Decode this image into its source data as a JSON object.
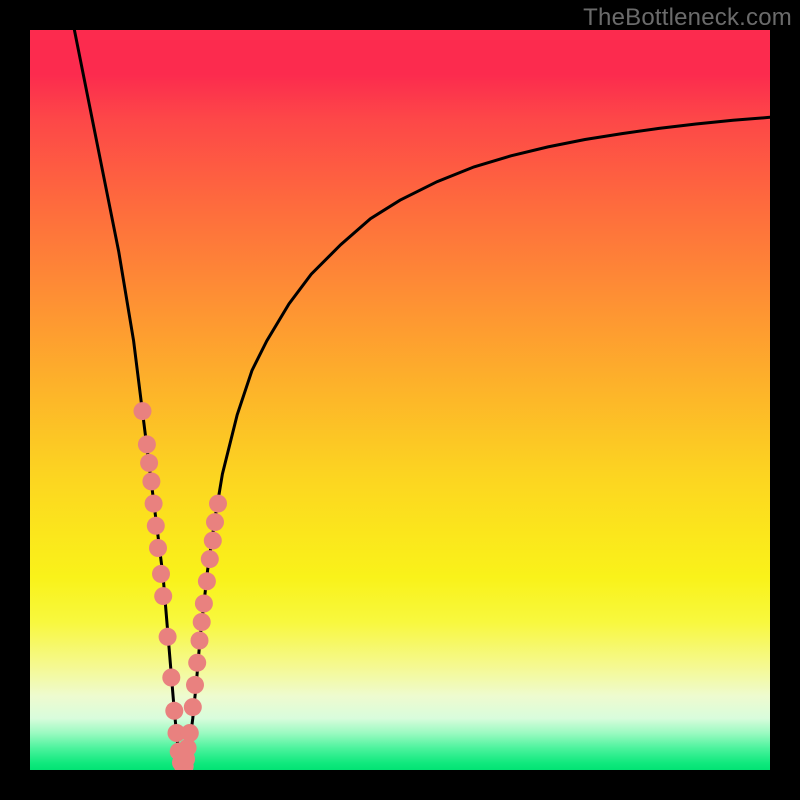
{
  "watermark": "TheBottleneck.com",
  "colors": {
    "frame": "#000000",
    "curve": "#000000",
    "marker": "#e9817f",
    "gradient_top": "#fc2b4e",
    "gradient_bottom": "#02e374"
  },
  "chart_data": {
    "type": "line",
    "title": "",
    "xlabel": "",
    "ylabel": "",
    "xlim": [
      0,
      100
    ],
    "ylim": [
      0,
      100
    ],
    "series": [
      {
        "name": "bottleneck-curve",
        "x": [
          6,
          8,
          10,
          12,
          14,
          15,
          16,
          17,
          18,
          18.5,
          19,
          19.5,
          20,
          20.5,
          21,
          21.5,
          22,
          22.5,
          23,
          24,
          25,
          26,
          27,
          28,
          30,
          32,
          35,
          38,
          42,
          46,
          50,
          55,
          60,
          65,
          70,
          75,
          80,
          85,
          90,
          95,
          100
        ],
        "y": [
          100,
          90,
          80,
          70,
          58,
          50,
          42,
          34,
          26,
          20,
          14,
          8,
          3,
          0.5,
          0.5,
          3,
          7,
          12,
          18,
          27,
          34,
          40,
          44,
          48,
          54,
          58,
          63,
          67,
          71,
          74.5,
          77,
          79.5,
          81.5,
          83,
          84.2,
          85.2,
          86,
          86.7,
          87.3,
          87.8,
          88.2
        ]
      }
    ],
    "markers": {
      "name": "highlighted-range",
      "x": [
        15.2,
        15.8,
        16.1,
        16.4,
        16.7,
        17.0,
        17.3,
        17.7,
        18.0,
        18.6,
        19.1,
        19.5,
        19.8,
        20.1,
        20.4,
        20.7,
        20.9,
        21.1,
        21.3,
        21.6,
        22.0,
        22.3,
        22.6,
        22.9,
        23.2,
        23.5,
        23.9,
        24.3,
        24.7,
        25.0,
        25.4
      ],
      "y": [
        48.5,
        44.0,
        41.5,
        39.0,
        36.0,
        33.0,
        30.0,
        26.5,
        23.5,
        18.0,
        12.5,
        8.0,
        5.0,
        2.5,
        1.0,
        0.5,
        0.5,
        1.5,
        3.0,
        5.0,
        8.5,
        11.5,
        14.5,
        17.5,
        20.0,
        22.5,
        25.5,
        28.5,
        31.0,
        33.5,
        36.0
      ]
    }
  }
}
